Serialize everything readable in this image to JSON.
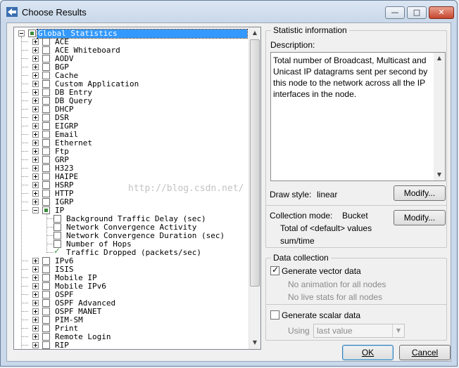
{
  "window": {
    "title": "Choose Results"
  },
  "title_buttons": {
    "minimize": "—",
    "maximize": "□",
    "close": "✕"
  },
  "tree": {
    "root": "Global Statistics",
    "items": [
      "ACE",
      "ACE Whiteboard",
      "AODV",
      "BGP",
      "Cache",
      "Custom Application",
      "DB Entry",
      "DB Query",
      "DHCP",
      "DSR",
      "EIGRP",
      "Email",
      "Ethernet",
      "Ftp",
      "GRP",
      "H323",
      "HAIPE",
      "HSRP",
      "HTTP",
      "IGRP",
      "IP",
      "IPv6",
      "ISIS",
      "Mobile IP",
      "Mobile IPv6",
      "OSPF",
      "OSPF Advanced",
      "OSPF MANET",
      "PIM-SM",
      "Print",
      "Remote Login",
      "RIP"
    ],
    "expanded_item": "IP",
    "ip_children": [
      "Background Traffic Delay (sec)",
      "Network Convergence Activity",
      "Network Convergence Duration (sec)",
      "Number of Hops",
      "Traffic Dropped (packets/sec)"
    ],
    "checked_child": "Traffic Dropped (packets/sec)"
  },
  "scrollbar": {
    "up_arrow": "▲",
    "down_arrow": "▼"
  },
  "statistic_info": {
    "legend": "Statistic information",
    "description_label": "Description:",
    "description_text": "Total number of Broadcast, Multicast and Unicast IP datagrams sent per second by this node to the network across all the IP interfaces in the node.",
    "draw_style_label": "Draw style:",
    "draw_style_value": "linear",
    "modify_label": "Modify...",
    "collection_mode_label": "Collection mode:",
    "collection_mode_value": "Bucket",
    "collection_detail_1": "Total of <default> values",
    "collection_detail_2": "sum/time"
  },
  "data_collection": {
    "legend": "Data collection",
    "vector_label": "Generate vector data",
    "vector_checked": true,
    "no_animation": "No animation for all nodes",
    "no_live_stats": "No live stats for all nodes",
    "scalar_label": "Generate scalar data",
    "scalar_checked": false,
    "using_label": "Using",
    "using_value": "last value"
  },
  "buttons": {
    "ok": "OK",
    "cancel": "Cancel"
  },
  "watermark": "http://blog.csdn.net/"
}
